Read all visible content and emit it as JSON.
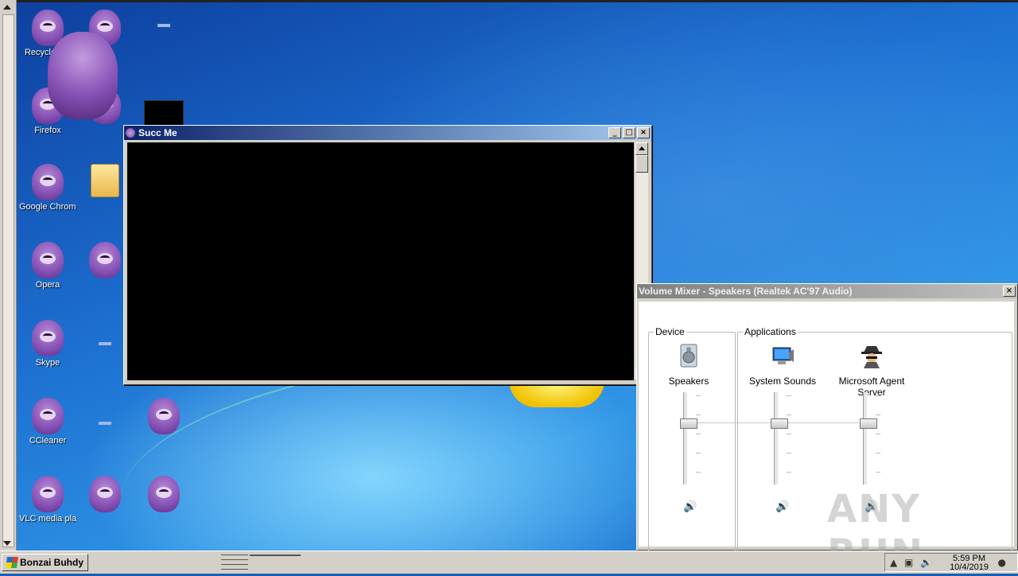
{
  "desktop": {
    "icons": [
      {
        "label": "Recycle Bin",
        "type": "gorilla"
      },
      {
        "label": "Firefox",
        "type": "gorilla"
      },
      {
        "label": "Google Chrome",
        "type": "gorilla"
      },
      {
        "label": "Opera",
        "type": "gorilla"
      },
      {
        "label": "Skype",
        "type": "gorilla"
      },
      {
        "label": "CCleaner",
        "type": "gorilla"
      },
      {
        "label": "VLC media player",
        "type": "gorilla"
      },
      {
        "label": "",
        "type": "gorilla"
      },
      {
        "label": "",
        "type": "gorilla"
      },
      {
        "label": "",
        "type": "folder"
      },
      {
        "label": "",
        "type": "gorilla"
      },
      {
        "label": "",
        "type": "gorilla"
      },
      {
        "label": "",
        "type": "gorilla"
      },
      {
        "label": "",
        "type": "gorilla"
      }
    ]
  },
  "succ_window": {
    "title": "Succ Me",
    "buttons": {
      "minimize": "_",
      "maximize": "□",
      "close": "×"
    }
  },
  "mixer": {
    "title": "Volume Mixer - Speakers (Realtek AC'97 Audio)",
    "close": "×",
    "device_group": "Device",
    "apps_group": "Applications",
    "channels": [
      {
        "name": "Speakers",
        "icon": "speaker-icon"
      },
      {
        "name": "System Sounds",
        "icon": "system-sounds-icon"
      },
      {
        "name": "Microsoft Agent Server",
        "icon": "agent-icon"
      }
    ],
    "mute_glyph": "🔊"
  },
  "watermark": "ANY RUN",
  "taskbar": {
    "start_label": "Bonzai Buhdy",
    "time": "5:59 PM",
    "date": "10/4/2019"
  }
}
